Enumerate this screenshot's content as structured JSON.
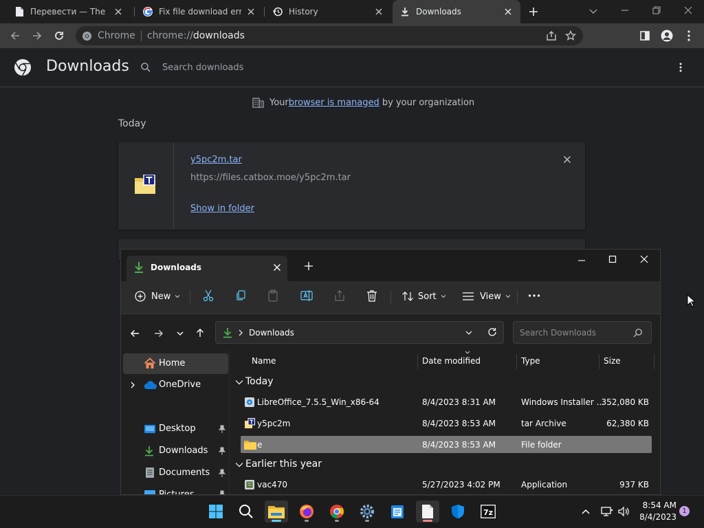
{
  "browser": {
    "tabs": [
      {
        "title": "Перевести — The Doc",
        "icon": "document-icon"
      },
      {
        "title": "Fix file download error",
        "icon": "google-icon"
      },
      {
        "title": "History",
        "icon": "history-icon"
      },
      {
        "title": "Downloads",
        "icon": "download-icon",
        "active": true
      }
    ],
    "omnibox": {
      "site_label": "Chrome",
      "url_prefix": "chrome://",
      "url_path": "downloads"
    }
  },
  "downloads_page": {
    "title": "Downloads",
    "search_placeholder": "Search downloads",
    "managed_notice": {
      "before": "Your ",
      "link": "browser is managed",
      "after": " by your organization"
    },
    "section_today": "Today",
    "item": {
      "filename": "y5pc2m.tar",
      "url": "https://files.catbox.moe/y5pc2m.tar",
      "action": "Show in folder"
    }
  },
  "explorer": {
    "tab_title": "Downloads",
    "ribbon": {
      "new": "New",
      "sort": "Sort",
      "view": "View"
    },
    "breadcrumb": "Downloads",
    "search_placeholder": "Search Downloads",
    "nav": {
      "home": "Home",
      "onedrive": "OneDrive",
      "desktop": "Desktop",
      "downloads": "Downloads",
      "documents": "Documents",
      "pictures": "Pictures"
    },
    "columns": {
      "name": "Name",
      "date": "Date modified",
      "type": "Type",
      "size": "Size"
    },
    "groups": {
      "today": "Today",
      "earlier": "Earlier this year"
    },
    "files_today": [
      {
        "name": "LibreOffice_7.5.5_Win_x86-64",
        "date": "8/4/2023 8:31 AM",
        "type": "Windows Installer ...",
        "size": "352,080 KB",
        "icon": "msi-installer-icon"
      },
      {
        "name": "y5pc2m",
        "date": "8/4/2023 8:53 AM",
        "type": "tar Archive",
        "size": "62,380 KB",
        "icon": "tar-archive-icon"
      },
      {
        "name": "e",
        "date": "8/4/2023 8:53 AM",
        "type": "File folder",
        "size": "",
        "icon": "folder-icon",
        "selected": true
      }
    ],
    "files_earlier": [
      {
        "name": "vac470",
        "date": "5/27/2023 4:02 PM",
        "type": "Application",
        "size": "937 KB",
        "icon": "application-icon"
      }
    ]
  },
  "taskbar": {
    "time": "8:54 AM",
    "date": "8/4/2023",
    "notification_count": "1",
    "apps": [
      "start-icon",
      "search-icon",
      "file-explorer-icon",
      "firefox-icon",
      "chrome-icon",
      "settings-icon",
      "notepad-icon",
      "document-app-icon",
      "defender-icon",
      "7zip-icon"
    ]
  },
  "colors": {
    "accent_link": "#8ab4f8",
    "selection": "#777777",
    "download_green": "#4caf50"
  }
}
